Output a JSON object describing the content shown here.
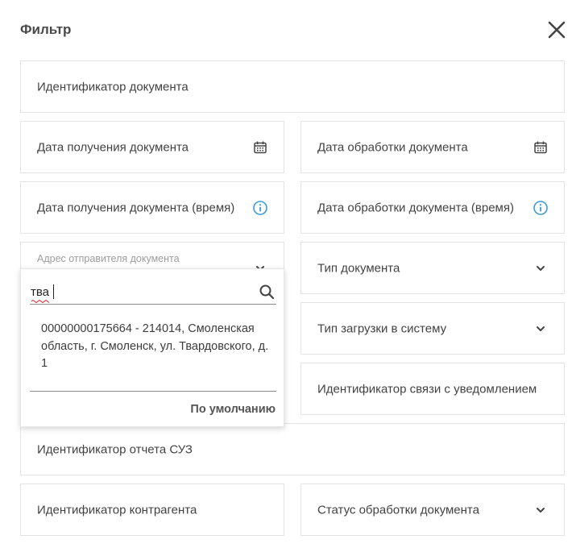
{
  "header": {
    "title": "Фильтр"
  },
  "fields": {
    "doc_id": "Идентификатор документа",
    "receive_date": "Дата получения документа",
    "process_date": "Дата обработки документа",
    "receive_time": "Дата получения документа (время)",
    "process_time": "Дата обработки документа (время)",
    "sender_address": "Адрес отправителя документа",
    "doc_type": "Тип документа",
    "upload_type": "Тип загрузки в систему",
    "link_id": "Идентификатор связи с уведомлением",
    "suz_report_id": "Идентификатор отчета СУЗ",
    "counterparty_id": "Идентификатор контрагента",
    "process_status": "Статус обработки документа"
  },
  "dropdown": {
    "search_value": "тва",
    "option": "00000000175664 - 214014, Смоленская область, г. Смоленск, ул. Твардовского, д. 1",
    "default_button": "По умолчанию"
  },
  "colors": {
    "info_icon": "#3a9bd9",
    "border": "#e3e3e3",
    "spellcheck": "#e02020"
  }
}
